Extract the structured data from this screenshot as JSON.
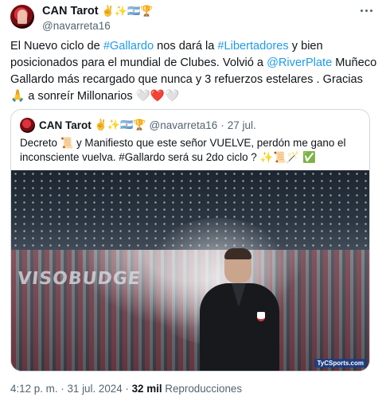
{
  "author": {
    "name": "CAN Tarot",
    "emojis": "✌️✨🇦🇷🏆",
    "handle": "@navarreta16"
  },
  "tweet": {
    "line1_pre": "El Nuevo ciclo de ",
    "hashtag_gallardo": "#Gallardo",
    "line1_mid": " nos dará la ",
    "hashtag_libertadores": "#Libertadores",
    "line1_post": " y  bien posicionados para el mundial de Clubes. Volvió a ",
    "mention_riverplate": "@RiverPlate",
    "line2": "  Muñeco Gallardo más recargado que nunca y 3 refuerzos estelares . Gracias 🙏 a sonreír Millonarios ",
    "hearts": [
      "🤍",
      "❤️",
      "🤍"
    ]
  },
  "quote": {
    "name": "CAN Tarot",
    "emojis": "✌️✨🇦🇷🏆",
    "handle": "@navarreta16",
    "separator": "·",
    "date": "27 jul.",
    "text": "Decreto 📜 y Manifiesto que este señor  VUELVE, perdón me gano el inconsciente vuelva. #Gallardo será su 2do ciclo ? ✨📜🪄 ✅",
    "media_banner": "VISOBUDGE",
    "media_watermark": "TyCSports.com"
  },
  "meta": {
    "time": "4:12 p. m.",
    "separator1": " · ",
    "date": "31 jul. 2024",
    "separator2": " · ",
    "views_count": "32 mil",
    "views_label": " Reproducciones"
  },
  "icons": {
    "more": "more-horizontal-icon"
  },
  "colors": {
    "link": "#1d9bf0",
    "secondary_text": "#536471",
    "border": "#cfd9de"
  }
}
